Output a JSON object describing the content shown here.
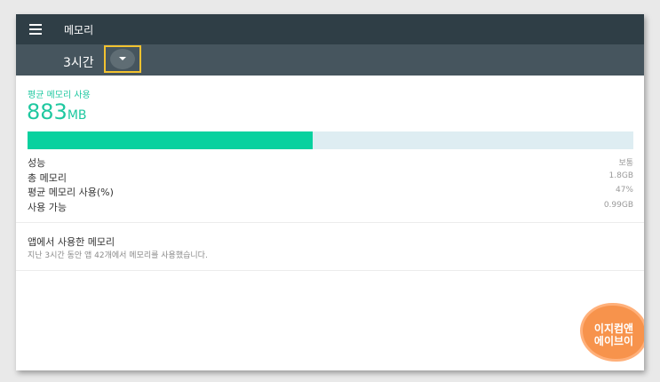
{
  "header": {
    "menu_icon": "hamburger-menu-icon",
    "title": "메모리"
  },
  "period": {
    "selected": "3시간",
    "dropdown_icon": "caret-down-icon"
  },
  "colors": {
    "topbar": "#2f3e46",
    "subbar": "#46555e",
    "accent": "#1fc8a0",
    "bar_fill": "#08d19f",
    "bar_track": "#deedf2",
    "highlight_border": "#f2c230"
  },
  "summary": {
    "avg_label": "평균 메모리 사용",
    "avg_value": "883",
    "avg_unit": "MB",
    "usage_fraction": 0.47
  },
  "stats": [
    {
      "label": "성능",
      "value": "보통"
    },
    {
      "label": "총 메모리",
      "value": "1.8GB"
    },
    {
      "label": "평균 메모리 사용(%)",
      "value": "47%"
    },
    {
      "label": "사용 가능",
      "value": "0.99GB"
    }
  ],
  "apps_section": {
    "title": "앱에서 사용한 메모리",
    "description": "지난 3시간 동안 앱 42개에서 메모리를 사용했습니다."
  },
  "watermark": {
    "line1": "이지컴앤",
    "line2": "에이브이"
  }
}
